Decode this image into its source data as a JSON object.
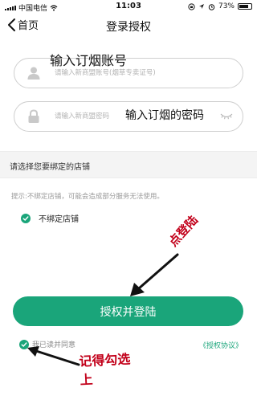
{
  "status_bar": {
    "carrier": "中国电信",
    "time": "11:03",
    "battery_percent": "73%"
  },
  "nav": {
    "back_label": "首页",
    "title": "登录授权"
  },
  "form": {
    "account_placeholder": "请输入新商盟账号(烟草专卖证号)",
    "password_placeholder": "请输入新商盟密码"
  },
  "section": {
    "bind_title": "请选择您要绑定的店铺",
    "tip": "提示:不绑定店铺，可能会造成部分服务无法使用。",
    "option_no_bind": "不绑定店铺"
  },
  "actions": {
    "submit_label": "授权并登陆",
    "agree_label": "我已读并同意",
    "protocol_link": "《授权协议》"
  },
  "annotations": {
    "account_note": "输入订烟账号",
    "password_note": "输入订烟的密码",
    "click_note": "点登陆",
    "check_note_line1": "记得勾选",
    "check_note_line2": "上"
  },
  "icons": {
    "wifi": "wifi-icon",
    "location": "location-icon",
    "lock_rotation": "orientation-lock-icon",
    "alarm": "alarm-icon",
    "battery": "battery-icon",
    "back": "chevron-left-icon",
    "user": "user-icon",
    "lock": "lock-icon",
    "eye": "eye-closed-icon",
    "check": "check-icon"
  },
  "colors": {
    "accent": "#1aa57a",
    "annotation": "#c2001a"
  }
}
